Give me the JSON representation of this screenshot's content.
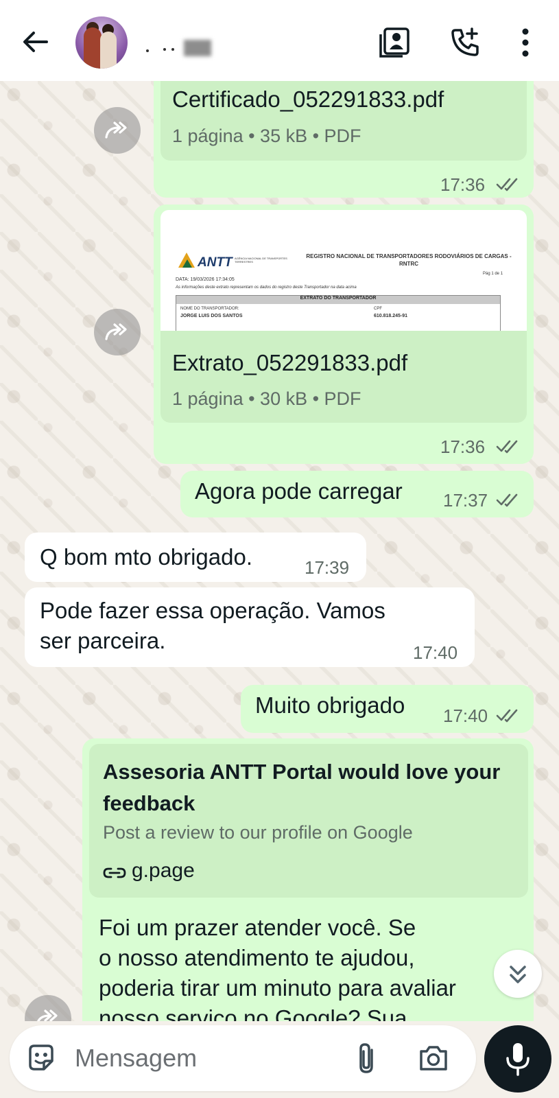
{
  "header": {
    "contact_name": "·",
    "icons": [
      "back-arrow-icon",
      "contact-card-icon",
      "add-call-icon",
      "more-vert-icon"
    ]
  },
  "messages": [
    {
      "type": "document",
      "direction": "outgoing",
      "file_name": "Certificado_052291833.pdf",
      "meta": "1 página • 35 kB • PDF",
      "time": "17:36",
      "status": "read"
    },
    {
      "type": "document",
      "direction": "outgoing",
      "file_name": "Extrato_052291833.pdf",
      "meta": "1 página • 30 kB • PDF",
      "time": "17:36",
      "status": "read",
      "preview": {
        "logo": "ANTT",
        "logo_sub": "AGÊNCIA NACIONAL DE TRANSPORTES TERRESTRES",
        "title": "REGISTRO NACIONAL DE TRANSPORTADORES RODOVIÁRIOS DE CARGAS - RNTRC",
        "page": "Pág 1 de 1",
        "date": "DATA: 19/03/2026 17:34:05",
        "note": "As informações deste extrato representam os dados do registro deste Transportador na data acima",
        "table_header": "EXTRATO DO TRANSPORTADOR",
        "label_name": "NOME DO TRANSPORTADOR:",
        "value_name": "JORGE LUIS DOS SANTOS",
        "label_cpf": "CPF",
        "value_cpf": "610.818.245-91"
      }
    },
    {
      "type": "text",
      "direction": "outgoing",
      "text": "Agora pode carregar",
      "time": "17:37",
      "status": "read"
    },
    {
      "type": "text",
      "direction": "incoming",
      "text": "Q bom mto obrigado.",
      "time": "17:39"
    },
    {
      "type": "text",
      "direction": "incoming",
      "text_line1": "Pode fazer essa operação. Vamos",
      "text_line2": "ser parceira.",
      "time": "17:40"
    },
    {
      "type": "text",
      "direction": "outgoing",
      "text": "Muito obrigado",
      "time": "17:40",
      "status": "read"
    },
    {
      "type": "link",
      "direction": "outgoing",
      "card_title": "Assesoria ANTT Portal would love your feedback",
      "card_description": "Post a review to our profile on Google",
      "card_link": "g.page",
      "text_line1": "Foi um prazer atender você. Se",
      "text_line2": "o nosso atendimento te ajudou,",
      "text_line3": "poderia tirar um minuto para avaliar",
      "text_line4": "nosso serviço no Google? Sua"
    }
  ],
  "composer": {
    "placeholder": "Mensagem",
    "icons": [
      "sticker-icon",
      "attach-icon",
      "camera-icon",
      "mic-icon"
    ]
  },
  "colors": {
    "outgoing_bubble": "#d9fdd3",
    "incoming_bubble": "#ffffff",
    "wallpaper": "#f4f0ea",
    "header_bg": "#ffffff"
  }
}
